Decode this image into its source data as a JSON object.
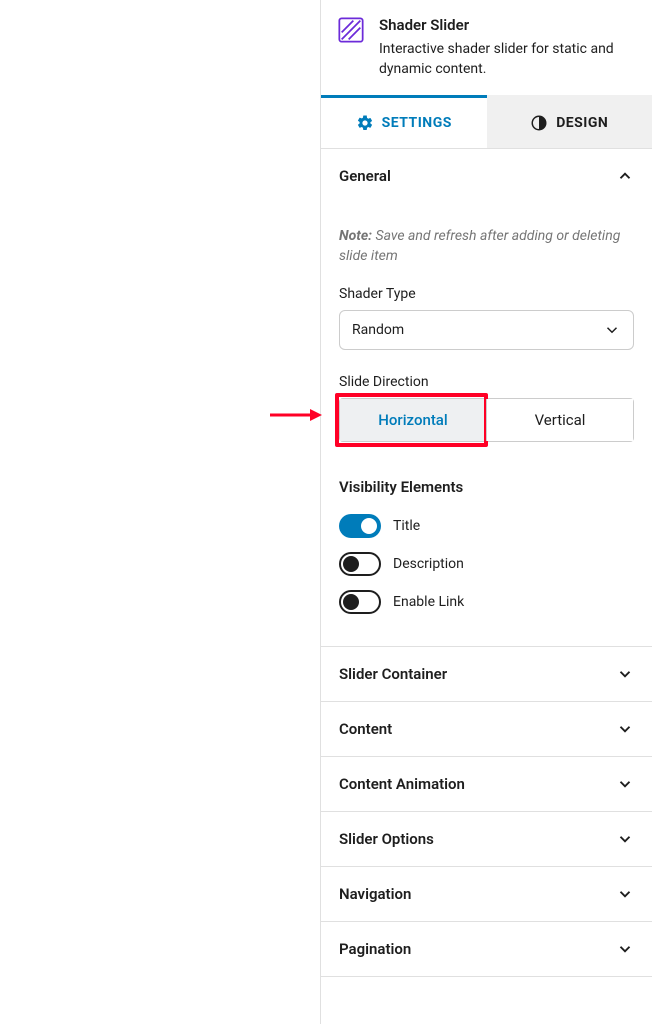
{
  "block": {
    "title": "Shader Slider",
    "description": "Interactive shader slider for static and dynamic content."
  },
  "tabs": {
    "settings": "SETTINGS",
    "design": "DESIGN"
  },
  "general": {
    "heading": "General",
    "note_label": "Note:",
    "note_text": " Save and refresh after adding or deleting slide item",
    "shader_type_label": "Shader Type",
    "shader_type_value": "Random",
    "slide_direction_label": "Slide Direction",
    "direction_options": {
      "horizontal": "Horizontal",
      "vertical": "Vertical"
    },
    "visibility_heading": "Visibility Elements",
    "toggles": {
      "title": "Title",
      "description": "Description",
      "enable_link": "Enable Link"
    }
  },
  "sections": {
    "slider_container": "Slider Container",
    "content": "Content",
    "content_animation": "Content Animation",
    "slider_options": "Slider Options",
    "navigation": "Navigation",
    "pagination": "Pagination"
  }
}
